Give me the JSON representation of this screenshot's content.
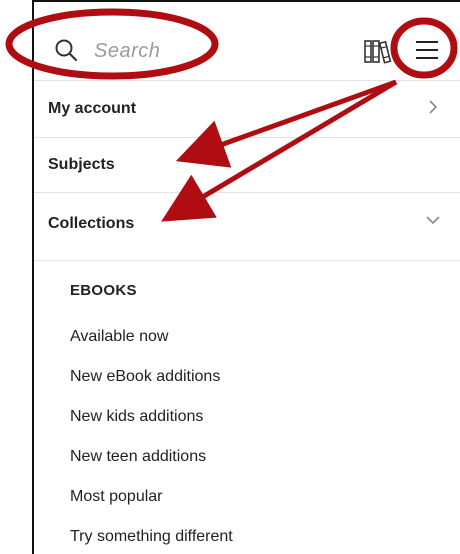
{
  "header": {
    "search_placeholder": "Search",
    "icons": {
      "search": "search-icon",
      "books": "books-icon",
      "menu": "hamburger-menu-icon"
    }
  },
  "menu": {
    "items": [
      {
        "label": "My account",
        "chevron": "chevron-right"
      },
      {
        "label": "Subjects",
        "chevron": ""
      },
      {
        "label": "Collections",
        "chevron": "chevron-down"
      }
    ],
    "collections": {
      "heading": "EBOOKS",
      "items": [
        "Available now",
        "New eBook additions",
        "New kids additions",
        "New teen additions",
        "Most popular",
        "Try something different"
      ]
    }
  },
  "colors": {
    "annotation": "#b00d12",
    "text": "#222222",
    "muted": "#9a9a9a",
    "divider": "#e3e3e3"
  }
}
